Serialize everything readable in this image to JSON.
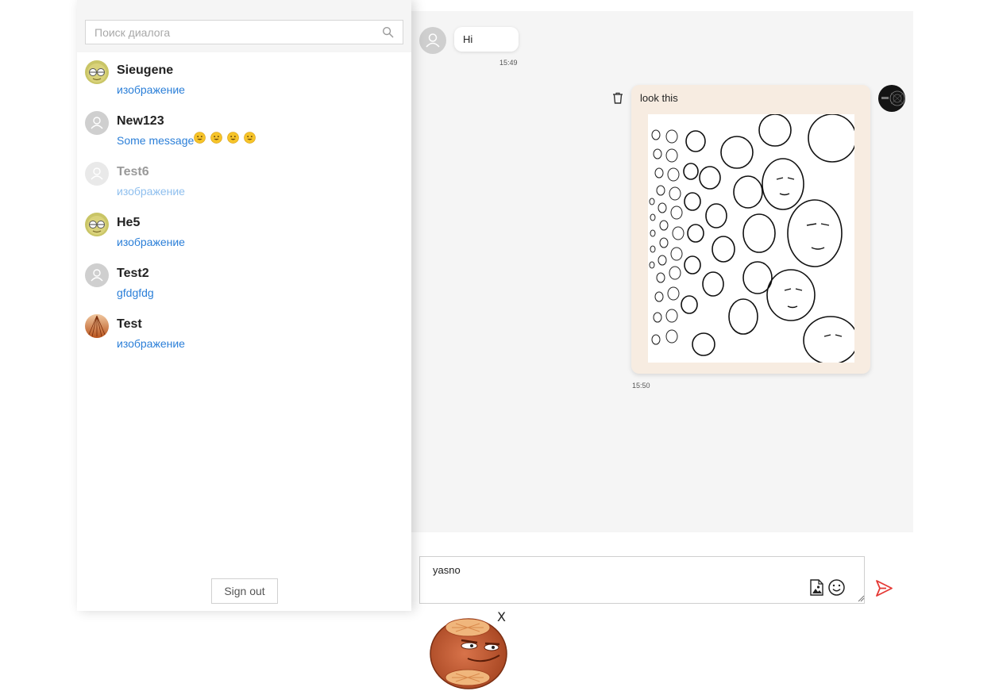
{
  "sidebar": {
    "search_placeholder": "Поиск диалога",
    "dialogs": [
      {
        "name": "Sieugene",
        "last_message": "изображение",
        "avatar": "cartoon-avatar"
      },
      {
        "name": "New123",
        "last_message": "Some message",
        "emoji_count": 4,
        "avatar": "default-user"
      },
      {
        "name": "Test6",
        "last_message": "изображение",
        "avatar": "default-user",
        "state": "faded"
      },
      {
        "name": "He5",
        "last_message": "изображение",
        "avatar": "cartoon-avatar"
      },
      {
        "name": "Test2",
        "last_message": "gfdgfdg",
        "avatar": "default-user"
      },
      {
        "name": "Test",
        "last_message": "изображение",
        "avatar": "orange-abstract"
      }
    ],
    "signout_label": "Sign out"
  },
  "chat": {
    "messages": [
      {
        "direction": "incoming",
        "text": "Hi",
        "time": "15:49"
      },
      {
        "direction": "outgoing",
        "text": "look this",
        "time": "15:50",
        "attachment": "image"
      }
    ],
    "input_value": "yasno",
    "attached_sticker": "sticker",
    "close_label": "X"
  },
  "colors": {
    "link_blue": "#2b7fd8",
    "outgoing_bubble": "#f7ece1",
    "chat_bg": "#f5f5f5",
    "send_red": "#e53935"
  }
}
